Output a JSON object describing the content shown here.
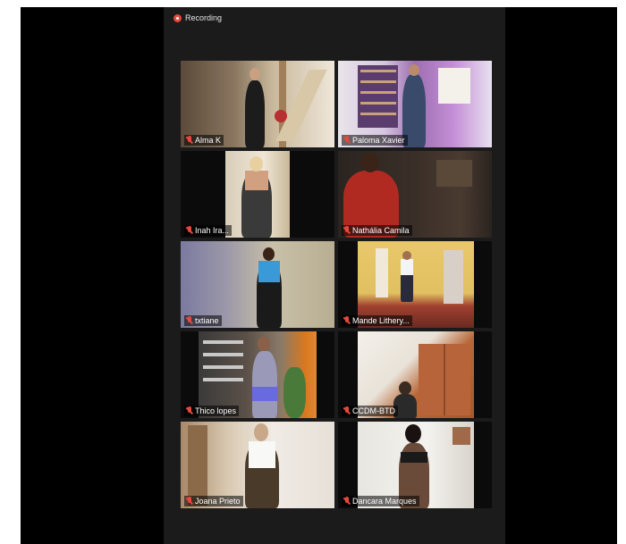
{
  "recording": {
    "label": "Recording"
  },
  "participants": [
    {
      "name": "Alma K"
    },
    {
      "name": "Paloma Xavier"
    },
    {
      "name": "Inah Ira..."
    },
    {
      "name": "Nathália Camila"
    },
    {
      "name": "txtiane"
    },
    {
      "name": "Mande Lithery..."
    },
    {
      "name": "Thico lopes"
    },
    {
      "name": "CCDM-BTD"
    },
    {
      "name": "Joana Prieto"
    },
    {
      "name": "Dancara Marques"
    }
  ],
  "colors": {
    "muted_mic": "#e5483c",
    "recording_dot": "#e5483c",
    "window_bg": "#1b1b1b"
  }
}
